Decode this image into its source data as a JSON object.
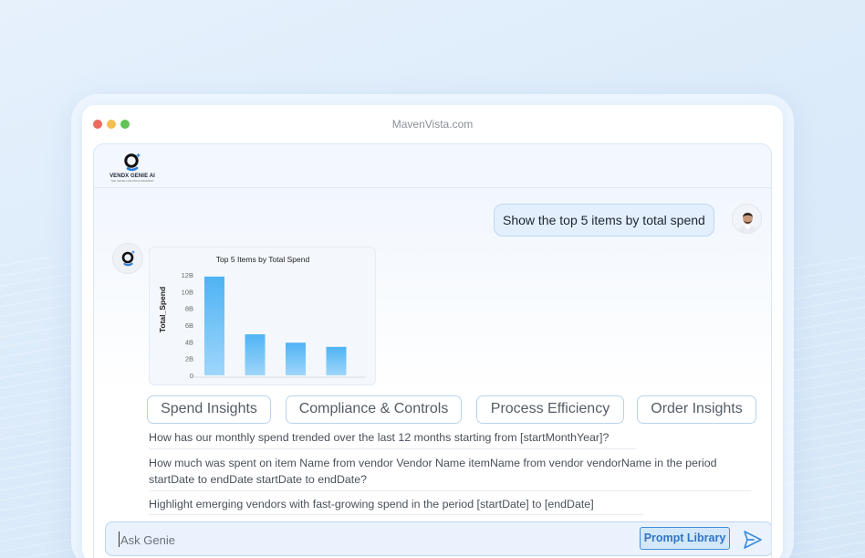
{
  "window": {
    "url": "MavenVista.com"
  },
  "brand": {
    "name": "VENDX GENIE AI",
    "tagline": "THE GENIE FOR PROCUREMENT"
  },
  "chat": {
    "user_message": "Show the top 5 items by total spend"
  },
  "chart_data": {
    "type": "bar",
    "title": "Top 5 Items by Total Spend",
    "ylabel": "Total_Spend",
    "xlabel": "",
    "yticks": [
      "12B",
      "10B",
      "8B",
      "6B",
      "4B",
      "2B",
      "0"
    ],
    "ylim": [
      0,
      13000000000
    ],
    "values": [
      11800000000,
      4900000000,
      3900000000,
      3400000000
    ],
    "colors": {
      "bar_top": "#4fb3f3",
      "bar_bottom": "#9fd6fb"
    }
  },
  "chips": [
    {
      "label": "Spend Insights"
    },
    {
      "label": "Compliance & Controls"
    },
    {
      "label": "Process Efficiency"
    },
    {
      "label": "Order Insights"
    }
  ],
  "suggestions": [
    {
      "line1": "How has our monthly spend trended over the last 12 months starting from [startMonthYear]?"
    },
    {
      "line1": "How much was spent on item Name from vendor Vendor Name itemName from vendor vendorName in the period",
      "line2": "startDate to endDate startDate to endDate?"
    },
    {
      "line1": "Highlight emerging vendors with fast-growing spend in the period [startDate] to [endDate]"
    }
  ],
  "input": {
    "placeholder": "Ask Genie",
    "prompt_library_label": "Prompt Library"
  },
  "colors": {
    "accent": "#2f76c4",
    "chip_border": "#b8d2ee"
  }
}
